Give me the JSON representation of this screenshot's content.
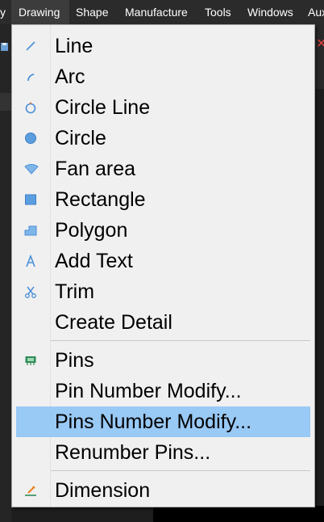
{
  "menubar": {
    "items": [
      {
        "label": "y"
      },
      {
        "label": "Drawing"
      },
      {
        "label": "Shape"
      },
      {
        "label": "Manufacture"
      },
      {
        "label": "Tools"
      },
      {
        "label": "Windows"
      },
      {
        "label": "Aux"
      }
    ],
    "active": "Drawing"
  },
  "dropdown": {
    "items": [
      {
        "label": "Line",
        "icon": "line-icon"
      },
      {
        "label": "Arc",
        "icon": "arc-icon"
      },
      {
        "label": "Circle Line",
        "icon": "circle-line-icon"
      },
      {
        "label": "Circle",
        "icon": "circle-icon"
      },
      {
        "label": "Fan area",
        "icon": "fan-area-icon"
      },
      {
        "label": "Rectangle",
        "icon": "rectangle-icon"
      },
      {
        "label": "Polygon",
        "icon": "polygon-icon"
      },
      {
        "label": "Add Text",
        "icon": "text-icon"
      },
      {
        "label": "Trim",
        "icon": "scissors-icon"
      },
      {
        "label": "Create Detail",
        "icon": ""
      },
      {
        "label": "Pins",
        "icon": "pins-icon"
      },
      {
        "label": "Pin Number Modify...",
        "icon": ""
      },
      {
        "label": "Pins Number Modify...",
        "icon": "",
        "highlighted": true
      },
      {
        "label": "Renumber Pins...",
        "icon": ""
      },
      {
        "label": "Dimension",
        "icon": "dimension-icon"
      }
    ]
  },
  "colors": {
    "menubar_bg": "#2b2b2b",
    "menu_bg": "#f0f0f0",
    "highlight": "#99c9f5",
    "icon_blue": "#4a8fd8",
    "pins_green": "#2e8b57",
    "dimension_orange": "#e87d1e"
  }
}
